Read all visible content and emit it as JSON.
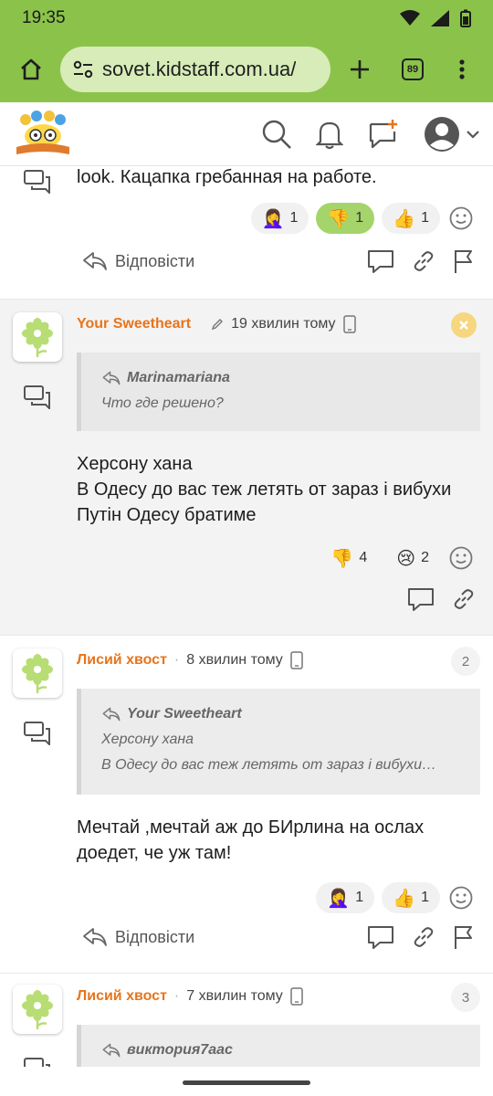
{
  "status": {
    "time": "19:35"
  },
  "browser": {
    "url": "sovet.kidstaff.com.ua/",
    "tabs_count": "89"
  },
  "posts": [
    {
      "body": "look. Кацапка гребанная на работе.",
      "reactions": [
        {
          "emoji": "🤦‍♀️",
          "count": "1",
          "active": false
        },
        {
          "emoji": "👎",
          "count": "1",
          "active": true
        },
        {
          "emoji": "👍",
          "count": "1",
          "active": false
        }
      ],
      "reply_label": "Відповісти"
    },
    {
      "author": "Your Sweetheart",
      "time": "19 хвилин тому",
      "quote": {
        "author": "Marinamariana",
        "lines": [
          "Что где решено?"
        ]
      },
      "body_lines": [
        "Херсону хана",
        "В Одесу до вас теж летять от зараз і вибухи",
        "Путін Одесу братиме"
      ],
      "reactions": [
        {
          "emoji": "👎",
          "count": "4",
          "active": false
        },
        {
          "emoji": "😢",
          "count": "2",
          "active": false
        }
      ]
    },
    {
      "author": "Лисий хвост",
      "time": "8 хвилин тому",
      "number": "2",
      "quote": {
        "author": "Your Sweetheart",
        "lines": [
          "Херсону хана",
          "В Одесу до вас теж летять от зараз і вибухи…"
        ]
      },
      "body_lines": [
        "Мечтай ,мечтай аж до БИрлина на ослах",
        "доедет, че уж там!"
      ],
      "reactions": [
        {
          "emoji": "🤦‍♀️",
          "count": "1",
          "active": false
        },
        {
          "emoji": "👍",
          "count": "1",
          "active": false
        }
      ],
      "reply_label": "Відповісти"
    },
    {
      "author": "Лисий хвост",
      "time": "7 хвилин тому",
      "number": "3",
      "quote": {
        "author": "виктория7аас"
      }
    }
  ],
  "colors": {
    "browser_green": "#8bc34a",
    "author_orange": "#e8741a",
    "active_reaction": "#a5d46a"
  }
}
